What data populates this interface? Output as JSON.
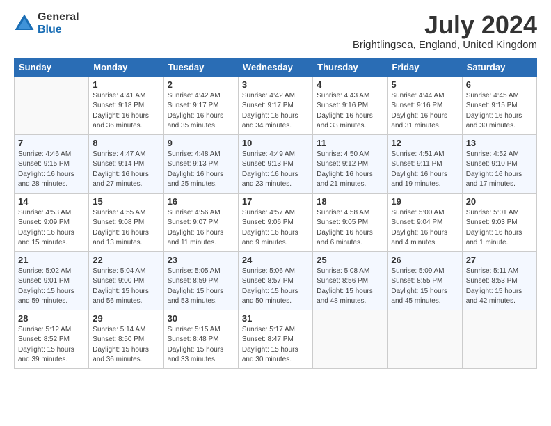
{
  "logo": {
    "general": "General",
    "blue": "Blue"
  },
  "title": "July 2024",
  "location": "Brightlingsea, England, United Kingdom",
  "days_header": [
    "Sunday",
    "Monday",
    "Tuesday",
    "Wednesday",
    "Thursday",
    "Friday",
    "Saturday"
  ],
  "weeks": [
    [
      {
        "day": "",
        "info": ""
      },
      {
        "day": "1",
        "info": "Sunrise: 4:41 AM\nSunset: 9:18 PM\nDaylight: 16 hours\nand 36 minutes."
      },
      {
        "day": "2",
        "info": "Sunrise: 4:42 AM\nSunset: 9:17 PM\nDaylight: 16 hours\nand 35 minutes."
      },
      {
        "day": "3",
        "info": "Sunrise: 4:42 AM\nSunset: 9:17 PM\nDaylight: 16 hours\nand 34 minutes."
      },
      {
        "day": "4",
        "info": "Sunrise: 4:43 AM\nSunset: 9:16 PM\nDaylight: 16 hours\nand 33 minutes."
      },
      {
        "day": "5",
        "info": "Sunrise: 4:44 AM\nSunset: 9:16 PM\nDaylight: 16 hours\nand 31 minutes."
      },
      {
        "day": "6",
        "info": "Sunrise: 4:45 AM\nSunset: 9:15 PM\nDaylight: 16 hours\nand 30 minutes."
      }
    ],
    [
      {
        "day": "7",
        "info": "Sunrise: 4:46 AM\nSunset: 9:15 PM\nDaylight: 16 hours\nand 28 minutes."
      },
      {
        "day": "8",
        "info": "Sunrise: 4:47 AM\nSunset: 9:14 PM\nDaylight: 16 hours\nand 27 minutes."
      },
      {
        "day": "9",
        "info": "Sunrise: 4:48 AM\nSunset: 9:13 PM\nDaylight: 16 hours\nand 25 minutes."
      },
      {
        "day": "10",
        "info": "Sunrise: 4:49 AM\nSunset: 9:13 PM\nDaylight: 16 hours\nand 23 minutes."
      },
      {
        "day": "11",
        "info": "Sunrise: 4:50 AM\nSunset: 9:12 PM\nDaylight: 16 hours\nand 21 minutes."
      },
      {
        "day": "12",
        "info": "Sunrise: 4:51 AM\nSunset: 9:11 PM\nDaylight: 16 hours\nand 19 minutes."
      },
      {
        "day": "13",
        "info": "Sunrise: 4:52 AM\nSunset: 9:10 PM\nDaylight: 16 hours\nand 17 minutes."
      }
    ],
    [
      {
        "day": "14",
        "info": "Sunrise: 4:53 AM\nSunset: 9:09 PM\nDaylight: 16 hours\nand 15 minutes."
      },
      {
        "day": "15",
        "info": "Sunrise: 4:55 AM\nSunset: 9:08 PM\nDaylight: 16 hours\nand 13 minutes."
      },
      {
        "day": "16",
        "info": "Sunrise: 4:56 AM\nSunset: 9:07 PM\nDaylight: 16 hours\nand 11 minutes."
      },
      {
        "day": "17",
        "info": "Sunrise: 4:57 AM\nSunset: 9:06 PM\nDaylight: 16 hours\nand 9 minutes."
      },
      {
        "day": "18",
        "info": "Sunrise: 4:58 AM\nSunset: 9:05 PM\nDaylight: 16 hours\nand 6 minutes."
      },
      {
        "day": "19",
        "info": "Sunrise: 5:00 AM\nSunset: 9:04 PM\nDaylight: 16 hours\nand 4 minutes."
      },
      {
        "day": "20",
        "info": "Sunrise: 5:01 AM\nSunset: 9:03 PM\nDaylight: 16 hours\nand 1 minute."
      }
    ],
    [
      {
        "day": "21",
        "info": "Sunrise: 5:02 AM\nSunset: 9:01 PM\nDaylight: 15 hours\nand 59 minutes."
      },
      {
        "day": "22",
        "info": "Sunrise: 5:04 AM\nSunset: 9:00 PM\nDaylight: 15 hours\nand 56 minutes."
      },
      {
        "day": "23",
        "info": "Sunrise: 5:05 AM\nSunset: 8:59 PM\nDaylight: 15 hours\nand 53 minutes."
      },
      {
        "day": "24",
        "info": "Sunrise: 5:06 AM\nSunset: 8:57 PM\nDaylight: 15 hours\nand 50 minutes."
      },
      {
        "day": "25",
        "info": "Sunrise: 5:08 AM\nSunset: 8:56 PM\nDaylight: 15 hours\nand 48 minutes."
      },
      {
        "day": "26",
        "info": "Sunrise: 5:09 AM\nSunset: 8:55 PM\nDaylight: 15 hours\nand 45 minutes."
      },
      {
        "day": "27",
        "info": "Sunrise: 5:11 AM\nSunset: 8:53 PM\nDaylight: 15 hours\nand 42 minutes."
      }
    ],
    [
      {
        "day": "28",
        "info": "Sunrise: 5:12 AM\nSunset: 8:52 PM\nDaylight: 15 hours\nand 39 minutes."
      },
      {
        "day": "29",
        "info": "Sunrise: 5:14 AM\nSunset: 8:50 PM\nDaylight: 15 hours\nand 36 minutes."
      },
      {
        "day": "30",
        "info": "Sunrise: 5:15 AM\nSunset: 8:48 PM\nDaylight: 15 hours\nand 33 minutes."
      },
      {
        "day": "31",
        "info": "Sunrise: 5:17 AM\nSunset: 8:47 PM\nDaylight: 15 hours\nand 30 minutes."
      },
      {
        "day": "",
        "info": ""
      },
      {
        "day": "",
        "info": ""
      },
      {
        "day": "",
        "info": ""
      }
    ]
  ]
}
